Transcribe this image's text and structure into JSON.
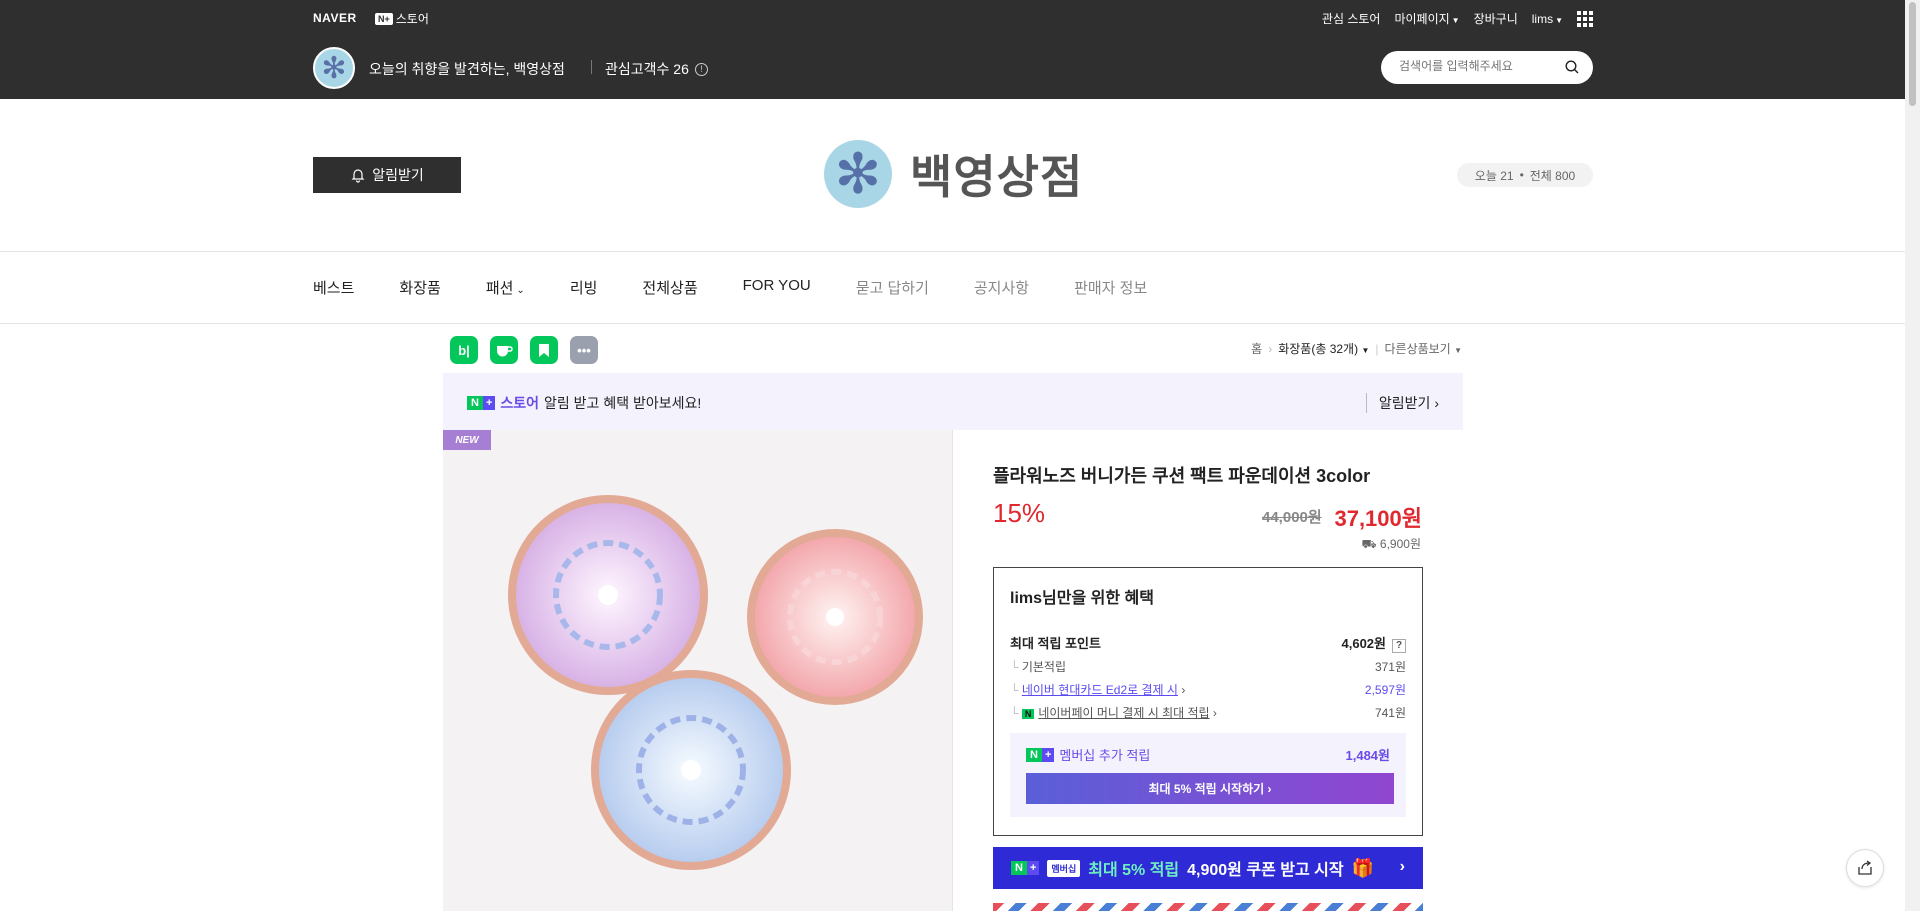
{
  "topbar": {
    "naver": "NAVER",
    "store_badge": "N+",
    "store_label": "스토어",
    "links": [
      "관심 스토어",
      "마이페이지",
      "장바구니",
      "lims"
    ],
    "slogan": "오늘의 취향을 발견하는, 백영상점",
    "followers_label": "관심고객수 26",
    "search_placeholder": "검색어를 입력해주세요"
  },
  "header": {
    "alarm_button": "알림받기",
    "brand_name": "백영상점",
    "visitors_today": "오늘 21",
    "visitors_total": "전체 800"
  },
  "nav": {
    "items": [
      "베스트",
      "화장품",
      "패션",
      "리빙",
      "전체상품",
      "FOR YOU",
      "묻고 답하기",
      "공지사항",
      "판매자 정보"
    ]
  },
  "share": {
    "buttons": [
      "b|",
      "blog",
      "keep",
      "more"
    ]
  },
  "breadcrumb": {
    "home": "홈",
    "category": "화장품(총 32개)",
    "other": "다른상품보기"
  },
  "benefit_banner": {
    "store_word": "스토어",
    "text": "알림 받고 혜택 받아보세요!",
    "action": "알림받기"
  },
  "product": {
    "new_tag": "NEW",
    "title": "플라워노즈 버니가든 쿠션 팩트 파운데이션 3color",
    "discount": "15%",
    "original_price": "44,000원",
    "sale_price": "37,100원",
    "shipping": "6,900원"
  },
  "benefits": {
    "title": "lims님만을 위한 혜택",
    "max_points_label": "최대 적립 포인트",
    "max_points_value": "4,602원",
    "qmark": "?",
    "rows": [
      {
        "label": "기본적립",
        "value": "371원"
      },
      {
        "label": "네이버 현대카드 Ed2로 결제 시",
        "value": "2,597원"
      },
      {
        "label": "네이버페이 머니 결제 시 최대 적립",
        "value": "741원"
      }
    ],
    "membership_label": "멤버십 추가 적립",
    "membership_value": "1,484원",
    "membership_button": "최대 5% 적립 시작하기 ›"
  },
  "promo": {
    "tag": "멤버십",
    "highlight": "최대 5% 적립",
    "text": "4,900원 쿠폰 받고 시작",
    "arrow": "›"
  },
  "colors": {
    "dark_bar": "#2f2f2f",
    "sale_red": "#e0282e",
    "naver_green": "#03c75a",
    "purple": "#6b4be7"
  }
}
